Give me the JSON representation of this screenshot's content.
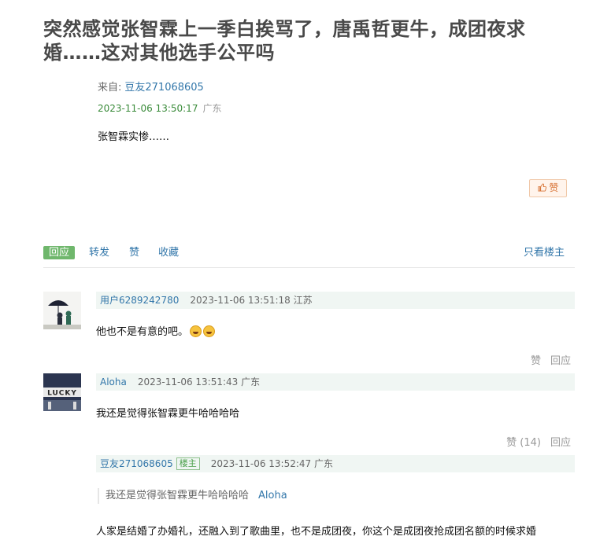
{
  "post": {
    "title": "突然感觉张智霖上一季白挨骂了，唐禹哲更牛，成团夜求婚……这对其他选手公平吗",
    "from_label": "来自:",
    "author": "豆友271068605",
    "time": "2023-11-06 13:50:17",
    "location": "广东",
    "content": "张智霖实惨……",
    "like_label": "赞"
  },
  "actions": {
    "reply": "回应",
    "forward": "转发",
    "like": "赞",
    "collect": "收藏",
    "only_op": "只看楼主"
  },
  "comments": [
    {
      "user": "用户6289242780",
      "time": "2023-11-06 13:51:18",
      "location": "江苏",
      "text": "他也不是有意的吧。",
      "like": "赞",
      "reply": "回应",
      "emoji": "grinning-squint-face-icon"
    },
    {
      "user": "Aloha",
      "time": "2023-11-06 13:51:43",
      "location": "广东",
      "text": "我还是觉得张智霖更牛哈哈哈哈",
      "like": "赞 (14)",
      "reply": "回应"
    },
    {
      "user": "豆友271068605",
      "op_badge": "楼主",
      "time": "2023-11-06 13:52:47",
      "location": "广东",
      "quote_text": "我还是觉得张智霖更牛哈哈哈哈",
      "quote_author": "Aloha",
      "text": "人家是结婚了办婚礼，还融入到了歌曲里，也不是成团夜，你这个是成团夜抢成团名额的时候求婚"
    }
  ],
  "colors": {
    "link": "#3377aa",
    "accent_green": "#6fb76c",
    "meta_bg": "#f0f6f3"
  }
}
